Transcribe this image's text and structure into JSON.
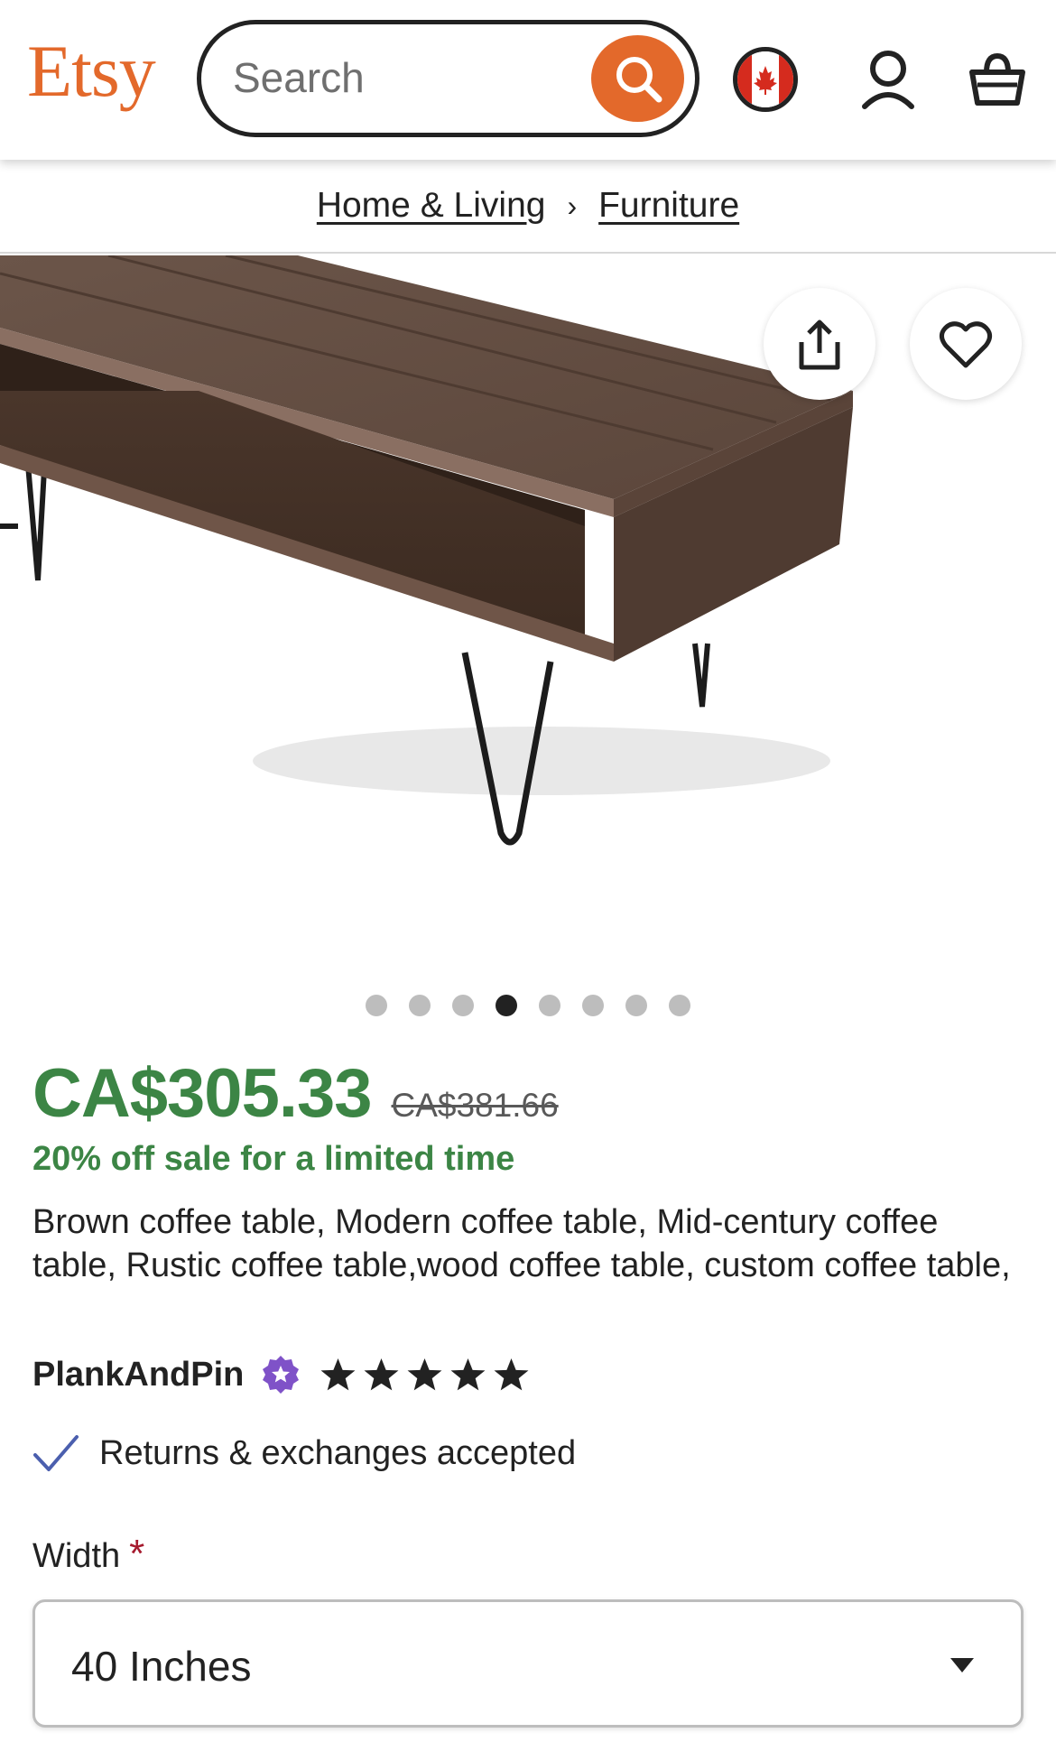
{
  "header": {
    "logo": "Etsy",
    "search_placeholder": "Search",
    "accent_color": "#e3692b",
    "icons": [
      "search-icon",
      "canada-flag-icon",
      "account-icon",
      "cart-icon"
    ]
  },
  "breadcrumb": {
    "items": [
      "Home & Living",
      "Furniture"
    ],
    "separator": "›"
  },
  "gallery": {
    "image_count": 8,
    "active_index": 4,
    "icons": [
      "share-icon",
      "heart-icon"
    ]
  },
  "product": {
    "price": "CA$305.33",
    "original_price": "CA$381.66",
    "sale_note": "20% off sale for a limited time",
    "title": "Brown coffee table, Modern coffee table, Mid-century coffee table, Rustic coffee table,wood coffee table, custom coffee table,",
    "price_color": "#3c8545"
  },
  "shop": {
    "name": "PlankAndPin",
    "rating": 5,
    "rating_max": 5,
    "badge_icon": "star-seller-icon",
    "badge_color": "#7f52c8"
  },
  "policy": {
    "returns_text": "Returns & exchanges accepted"
  },
  "options": {
    "width_label": "Width",
    "required_mark": "*",
    "width_value": "40 Inches"
  }
}
